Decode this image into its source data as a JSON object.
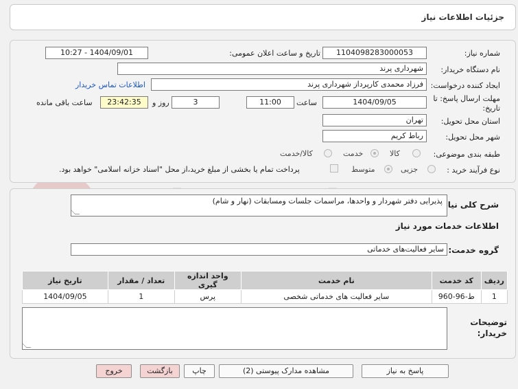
{
  "header": {
    "title": "جزئیات اطلاعات نیاز"
  },
  "details": {
    "need_number_label": "شماره نیاز:",
    "need_number": "1104098283000053",
    "announce_label": "تاریخ و ساعت اعلان عمومی:",
    "announce_value": "1404/09/01 - 10:27",
    "buyer_org_label": "نام دستگاه خریدار:",
    "buyer_org": "شهرداری پرند",
    "creator_label": "ایجاد کننده درخواست:",
    "creator": "فرزاد محمدی کارپرداز شهرداری پرند",
    "contact_link": "اطلاعات تماس خریدار",
    "deadline_label_1": "مهلت ارسال پاسخ: تا",
    "deadline_label_2": "تاریخ:",
    "deadline_date": "1404/09/05",
    "time_label": "ساعت",
    "deadline_time": "11:00",
    "days_value": "3",
    "days_label": "روز و",
    "remaining_value": "23:42:35",
    "remaining_label": "ساعت باقی مانده",
    "province_label": "استان محل تحویل:",
    "province": "تهران",
    "city_label": "شهر محل تحویل:",
    "city": "رباط کریم",
    "category_label": "طبقه بندی موضوعی:",
    "category_options": [
      "کالا",
      "خدمت",
      "کالا/خدمت"
    ],
    "category_selected": "خدمت",
    "process_label": "نوع فرآیند خرید :",
    "process_options": [
      "جزیی",
      "متوسط"
    ],
    "process_selected": "متوسط",
    "payment_note": "پرداخت تمام یا بخشی از مبلغ خرید،از محل \"اسناد خزانه اسلامی\" خواهد بود."
  },
  "description": {
    "label": "شرح کلی نیاز:",
    "value": "پذیرایی دفتر شهردار و واحدها، مراسمات جلسات ومسابقات (نهار و شام)"
  },
  "services": {
    "section_title": "اطلاعات خدمات مورد نیاز",
    "group_label": "گروه خدمت:",
    "group_value": "سایر فعالیت‌های خدماتی",
    "columns": [
      "ردیف",
      "کد خدمت",
      "نام خدمت",
      "واحد اندازه گیری",
      "تعداد / مقدار",
      "تاریخ نیاز"
    ],
    "rows": [
      [
        "1",
        "ط-96-960",
        "سایر فعالیت های خدماتی شخصی",
        "پرس",
        "1",
        "1404/09/05"
      ]
    ]
  },
  "buyer_notes": {
    "label_1": "توضیحات",
    "label_2": "خریدار:",
    "value": ""
  },
  "buttons": {
    "reply": "پاسخ به نیاز",
    "view_docs": "مشاهده مدارک پیوستی (2)",
    "print": "چاپ",
    "back": "بازگشت",
    "exit": "خروج"
  },
  "watermark": {
    "text": "AriaTender.net"
  }
}
